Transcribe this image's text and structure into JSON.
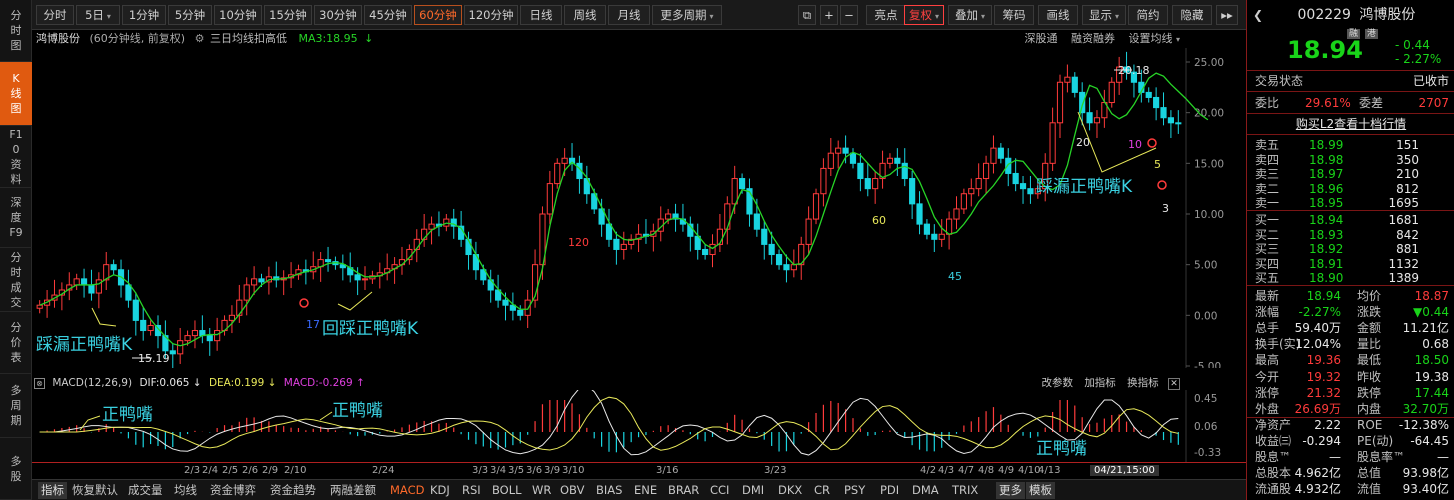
{
  "left_nav": [
    {
      "label": "分时图",
      "active": false
    },
    {
      "label": "K线图",
      "active": true
    },
    {
      "label": "F10资料",
      "active": false
    },
    {
      "label": "深度F9",
      "active": false
    },
    {
      "label": "分时成交",
      "active": false
    },
    {
      "label": "分价表",
      "active": false
    },
    {
      "label": "多周期",
      "active": false
    },
    {
      "label": "多股",
      "active": false
    }
  ],
  "toolbar": {
    "periods": [
      "分时",
      "5日",
      "1分钟",
      "5分钟",
      "10分钟",
      "15分钟",
      "30分钟",
      "45分钟",
      "60分钟",
      "120分钟",
      "日线",
      "周线",
      "月线",
      "更多周期"
    ],
    "active_period": "60分钟",
    "tools": [
      "亮点",
      "复权",
      "叠加",
      "筹码",
      "画线",
      "显示",
      "简约",
      "隐藏"
    ]
  },
  "chart_info": {
    "stock_name": "鸿博股份",
    "period_note": "(60分钟线, 前复权)",
    "indicator_name": "三日均线扣高低",
    "ma_label": "MA3:18.95",
    "arrow": "↓",
    "links": [
      "深股通",
      "融资融券",
      "设置均线"
    ]
  },
  "annotations": {
    "high_label": "20.18",
    "low_label": "15.19",
    "left_duck": "踩漏正鸭嘴K",
    "mid_duck": "回踩正鸭嘴K",
    "right_duck": "踩漏正鸭嘴K",
    "num_17": "17",
    "num_120": "120",
    "num_60": "60",
    "num_45": "45",
    "num_20": "20",
    "num_10": "10",
    "num_5": "5",
    "num_3": "3",
    "macd_duck1": "正鸭嘴",
    "macd_duck2": "正鸭嘴",
    "macd_duck3": "正鸭嘴"
  },
  "macd": {
    "label": "MACD(12,26,9)",
    "dif": "DIF:0.065",
    "dea": "DEA:0.199",
    "macd": "MACD:-0.269",
    "links": [
      "改参数",
      "加指标",
      "换指标"
    ],
    "axis": [
      "0.45",
      "0.06",
      "-0.33"
    ]
  },
  "date_axis": [
    "2/3",
    "2/4",
    "2/5",
    "2/6",
    "2/9",
    "2/10",
    "2/24",
    "3/3",
    "3/4",
    "3/5",
    "3/6",
    "3/9",
    "3/10",
    "3/16",
    "3/23",
    "4/2",
    "4/3",
    "4/7",
    "4/8",
    "4/9",
    "4/10",
    "4/13",
    "04/21,15:00"
  ],
  "bottom_tabs": [
    "指标",
    "恢复默认",
    "成交量",
    "均线",
    "资金博弈",
    "资金趋势",
    "两融差额",
    "MACD",
    "KDJ",
    "RSI",
    "BOLL",
    "WR",
    "OBV",
    "BIAS",
    "ENE",
    "BRAR",
    "CCI",
    "DMI",
    "DKX",
    "CR",
    "PSY",
    "PDI",
    "DMA",
    "TRIX",
    "更多",
    "模板"
  ],
  "active_bottom_tab": "MACD",
  "quote": {
    "code": "002229",
    "name": "鸿博股份",
    "badges": [
      "融",
      "港"
    ],
    "price": "18.94",
    "change": "- 0.44",
    "change_pct": "- 2.27%",
    "status_label": "交易状态",
    "status_value": "已收市",
    "webi_label": "委比",
    "webi_value": "29.61%",
    "weicha_label": "委差",
    "weicha_value": "2707",
    "l2_link": "购买L2查看十档行情",
    "asks": [
      {
        "label": "卖五",
        "price": "18.99",
        "vol": "151"
      },
      {
        "label": "卖四",
        "price": "18.98",
        "vol": "350"
      },
      {
        "label": "卖三",
        "price": "18.97",
        "vol": "210"
      },
      {
        "label": "卖二",
        "price": "18.96",
        "vol": "812"
      },
      {
        "label": "卖一",
        "price": "18.95",
        "vol": "1695"
      }
    ],
    "bids": [
      {
        "label": "买一",
        "price": "18.94",
        "vol": "1681"
      },
      {
        "label": "买二",
        "price": "18.93",
        "vol": "842"
      },
      {
        "label": "买三",
        "price": "18.92",
        "vol": "881"
      },
      {
        "label": "买四",
        "price": "18.91",
        "vol": "1132"
      },
      {
        "label": "买五",
        "price": "18.90",
        "vol": "1389"
      }
    ],
    "stats": [
      [
        "最新",
        "18.94",
        "均价",
        "18.87"
      ],
      [
        "涨幅",
        "-2.27%",
        "涨跌",
        "▼0.44"
      ],
      [
        "总手",
        "59.40万",
        "金额",
        "11.21亿"
      ],
      [
        "换手(实)",
        "12.04%",
        "量比",
        "0.68"
      ],
      [
        "最高",
        "19.36",
        "最低",
        "18.50"
      ],
      [
        "今开",
        "19.32",
        "昨收",
        "19.38"
      ],
      [
        "涨停",
        "21.32",
        "跌停",
        "17.44"
      ],
      [
        "外盘",
        "26.69万",
        "内盘",
        "32.70万"
      ],
      [
        "净资产",
        "2.22",
        "ROE",
        "-12.38%"
      ],
      [
        "收益㈢",
        "-0.294",
        "PE(动)",
        "-64.45"
      ],
      [
        "股息™",
        "—",
        "股息率™",
        "—"
      ],
      [
        "总股本",
        "4.962亿",
        "总值",
        "93.98亿"
      ],
      [
        "流通股",
        "4.932亿",
        "流值",
        "93.40亿"
      ]
    ]
  },
  "colors": {
    "up": "#ff3b3b",
    "down": "#19d4e0",
    "ma": "#27d427",
    "accent": "#ff6a2a",
    "dif": "#e8e8e8",
    "dea": "#e8e85a"
  },
  "chart_data": {
    "type": "candlestick",
    "y_axis_ticks": [
      "25.00",
      "20.00",
      "15.00",
      "10.00",
      "5.00",
      "0.00",
      "-5.00"
    ],
    "ylim": [
      -5,
      25
    ],
    "close": [
      1,
      1.5,
      2,
      2.5,
      3,
      3.6,
      3,
      2.2,
      3.5,
      5,
      4.5,
      3,
      1.5,
      -0.5,
      -1.5,
      -1,
      -2,
      -3.5,
      -3.8,
      -2.5,
      -2,
      -1.5,
      -2,
      -2.5,
      -1.5,
      -0.5,
      0,
      1.5,
      3,
      3.6,
      3.3,
      3.8,
      3.5,
      3.7,
      4,
      4.5,
      4.3,
      4.8,
      5.5,
      5.3,
      5,
      4.7,
      4,
      3.5,
      3.6,
      3.9,
      4.2,
      4.6,
      5,
      5.5,
      6.5,
      7.5,
      8.5,
      9,
      8.8,
      9.5,
      8.8,
      7.5,
      6,
      4.5,
      3.5,
      2.5,
      1.5,
      1,
      0.5,
      0,
      1.5,
      5,
      10,
      13,
      15,
      15.5,
      15,
      13.5,
      12,
      10.5,
      9,
      7.5,
      6.5,
      7,
      7.5,
      8,
      7.8,
      8.3,
      9.5,
      10,
      9.5,
      9,
      7.8,
      6.5,
      6,
      7,
      8.5,
      11,
      13.5,
      12.5,
      10,
      8.5,
      7,
      6,
      5,
      4.5,
      5,
      7,
      9.5,
      12,
      14.5,
      16,
      16.5,
      16,
      15,
      13.5,
      12.5,
      13.5,
      15,
      15.5,
      15,
      13.5,
      11,
      9,
      8,
      7.5,
      8,
      9.5,
      10.5,
      12,
      12.5,
      13.5,
      15,
      16.5,
      15.5,
      14,
      13,
      12.5,
      12,
      12.5,
      15,
      19,
      23,
      23.5,
      22,
      20,
      19,
      19.5,
      21,
      23,
      24.5,
      24,
      23,
      22,
      21.5,
      20.5,
      19.5,
      19,
      18.9
    ],
    "ma3": [
      1,
      1.3,
      1.7,
      2.1,
      2.6,
      3,
      3,
      3,
      3.1,
      3.6,
      4,
      3.8,
      3.2,
      2.2,
      0.8,
      -0.4,
      -1.3,
      -2.1,
      -2.8,
      -3,
      -2.8,
      -2.4,
      -2,
      -1.9,
      -1.9,
      -1.5,
      -0.8,
      0.1,
      1.1,
      2.2,
      3,
      3.5,
      3.6,
      3.6,
      3.8,
      4.1,
      4.3,
      4.5,
      4.8,
      5.1,
      5.2,
      5.1,
      4.7,
      4.2,
      3.8,
      3.8,
      3.9,
      4.2,
      4.6,
      5,
      5.7,
      6.6,
      7.6,
      8.4,
      8.8,
      9.1,
      9,
      8.6,
      7.4,
      6,
      4.7,
      3.5,
      2.6,
      1.8,
      1.1,
      0.6,
      0.6,
      1.9,
      4.6,
      8.8,
      12,
      14.3,
      15.1,
      14.5,
      13.6,
      12.2,
      10.7,
      9.2,
      8,
      7.5,
      7.4,
      7.6,
      7.8,
      8,
      8.7,
      9.4,
      9.6,
      9.5,
      8.8,
      7.9,
      7,
      6.6,
      7.1,
      8.6,
      10.8,
      12.4,
      12.2,
      10.9,
      9.3,
      7.9,
      6.8,
      5.8,
      5,
      5.1,
      6,
      7.8,
      10,
      12.2,
      14.3,
      15.6,
      16.1,
      15.8,
      15,
      14.2,
      13.6,
      13.9,
      14.5,
      14.7,
      14.4,
      13.2,
      11.5,
      9.7,
      8.6,
      8,
      8.2,
      9,
      10,
      11.2,
      12,
      12.8,
      13.8,
      14.9,
      15.3,
      15.2,
      14.3,
      13.4,
      12.7,
      12.4,
      12.9,
      14.8,
      17.8,
      20.7,
      22.7,
      22.4,
      21.1,
      19.9,
      19.4,
      19.8,
      20.8,
      22.1,
      23.4,
      23.9,
      23.6,
      22.8,
      22.1,
      21.4,
      20.6,
      19.8,
      19.3
    ]
  }
}
